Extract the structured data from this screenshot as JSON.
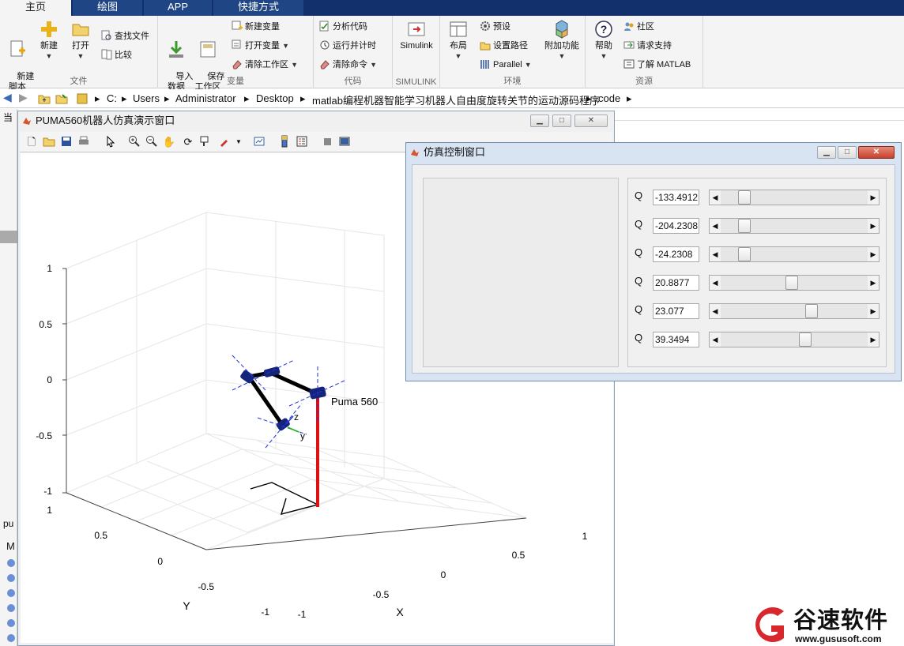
{
  "tabs": [
    "主页",
    "绘图",
    "APP",
    "快捷方式"
  ],
  "ribbon": {
    "file": {
      "label": "文件",
      "new_script": "新建\n脚本",
      "new": "新建",
      "open": "打开",
      "find_files": "查找文件",
      "compare": "比较"
    },
    "variable": {
      "label": "变量",
      "import": "导入\n数据",
      "save_ws": "保存\n工作区",
      "new_var": "新建变量",
      "open_var": "打开变量",
      "clear_ws": "清除工作区"
    },
    "code": {
      "label": "代码",
      "analyze": "分析代码",
      "run_time": "运行并计时",
      "clear_cmd": "清除命令"
    },
    "simulink": {
      "label": "SIMULINK",
      "btn": "Simulink"
    },
    "env": {
      "label": "环境",
      "layout": "布局",
      "prefs": "预设",
      "set_path": "设置路径",
      "parallel": "Parallel",
      "addons": "附加功能"
    },
    "resources": {
      "label": "资源",
      "help": "帮助",
      "community": "社区",
      "support": "请求支持",
      "learn": "了解 MATLAB"
    }
  },
  "address": {
    "parts": [
      "C:",
      "Users",
      "Administrator",
      "Desktop",
      "matlab编程机器智能学习机器人自由度旋转关节的运动源码程序",
      "code"
    ]
  },
  "left_strip": {
    "cur": "当",
    "pu": "pu",
    "m": "M"
  },
  "fig_window": {
    "title": "PUMA560机器人仿真演示窗口",
    "robot_label": "Puma 560",
    "z_label": "z",
    "y_label": "y",
    "axis_y_name": "Y",
    "axis_x_name": "X",
    "z_ticks": [
      "1",
      "0.5",
      "0",
      "-0.5",
      "-1"
    ],
    "y_ticks": [
      "1",
      "0.5",
      "0",
      "-0.5",
      "-1"
    ],
    "x_ticks": [
      "-1",
      "-0.5",
      "0",
      "0.5",
      "1"
    ]
  },
  "ctrl_window": {
    "title": "仿真控制窗口",
    "sliders": [
      {
        "label": "Q",
        "value": "-133.4912",
        "pos": 0.13
      },
      {
        "label": "Q",
        "value": "-204.2308",
        "pos": 0.13
      },
      {
        "label": "Q",
        "value": "-24.2308",
        "pos": 0.13
      },
      {
        "label": "Q",
        "value": "20.8877",
        "pos": 0.48
      },
      {
        "label": "Q",
        "value": "23.077",
        "pos": 0.63
      },
      {
        "label": "Q",
        "value": "39.3494",
        "pos": 0.58
      }
    ]
  },
  "watermark": {
    "brand": "谷速软件",
    "url": "www.gususoft.com"
  },
  "colors": {
    "tabbar": "#12306b",
    "accent_blue": "#1f4584",
    "robot_link": "#0c1a6e",
    "base_red": "#e11010",
    "watermark_red": "#d8272d"
  }
}
